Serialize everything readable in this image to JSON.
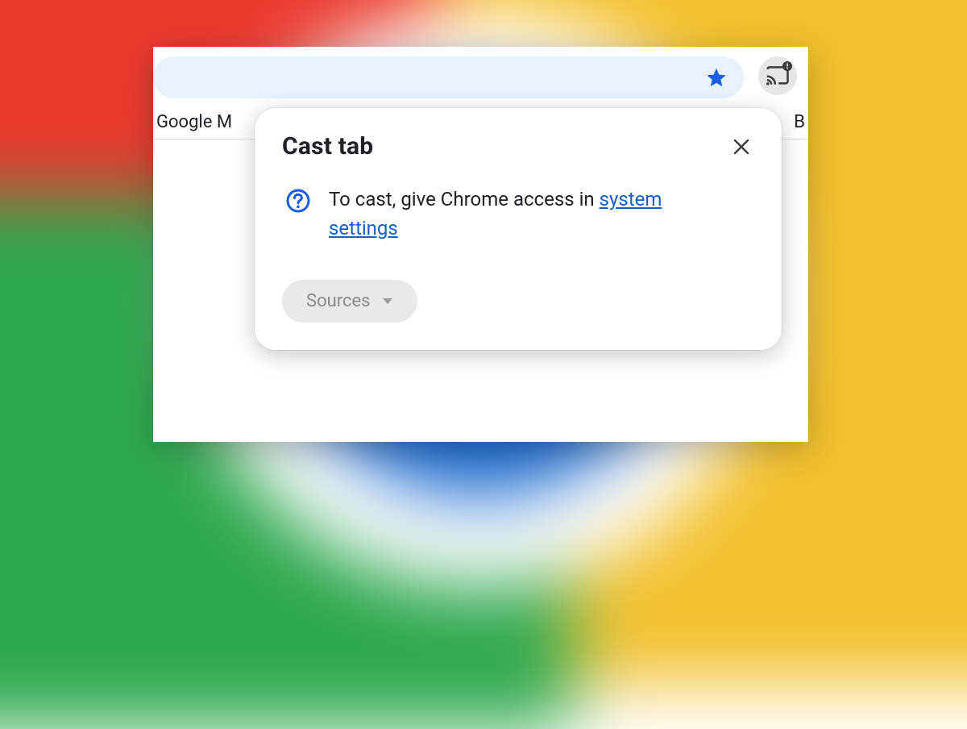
{
  "bookmarks": {
    "left_item": "Google M",
    "right_item": "B"
  },
  "popup": {
    "title": "Cast tab",
    "message_prefix": "To cast, give Chrome access in ",
    "message_link": "system settings",
    "sources_label": "Sources"
  },
  "icons": {
    "star": "star-icon",
    "cast": "cast-icon",
    "help": "help-icon",
    "close": "close-icon",
    "chevron_down": "chevron-down-icon"
  },
  "colors": {
    "link": "#1a5fc6",
    "omnibox_bg": "#e9f1fb",
    "sources_bg": "#e9e9e9"
  }
}
